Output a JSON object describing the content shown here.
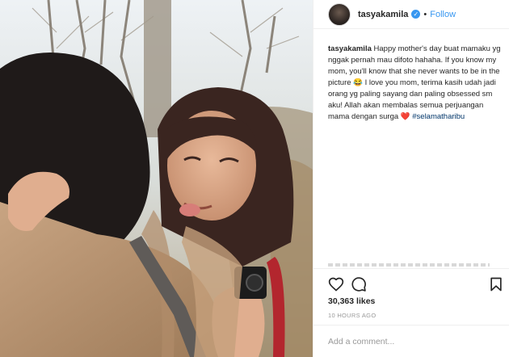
{
  "post": {
    "username": "tasyakamila",
    "verified": true,
    "follow_label": "Follow",
    "separator": "•"
  },
  "caption": {
    "username": "tasyakamila",
    "text": " Happy mother's day buat mamaku yg nggak pernah mau difoto hahaha. If you know my mom, you'll know that she never wants to be in the picture 😂 I love you mom, terima kasih udah jadi orang yg paling sayang dan paling obsessed sm aku! Allah akan membalas semua perjuangan mama dengan surga ❤️ ",
    "hashtag": "#selamatharibu"
  },
  "stats": {
    "likes": "30,363 likes",
    "time": "10 HOURS AGO"
  },
  "comment": {
    "placeholder": "Add a comment..."
  },
  "icons": {
    "like": "heart-icon",
    "comment": "comment-icon",
    "save": "bookmark-icon",
    "verified": "verified-badge-icon"
  },
  "colors": {
    "link": "#3897f0",
    "text": "#262626",
    "muted": "#999999",
    "hashtag": "#003569"
  }
}
